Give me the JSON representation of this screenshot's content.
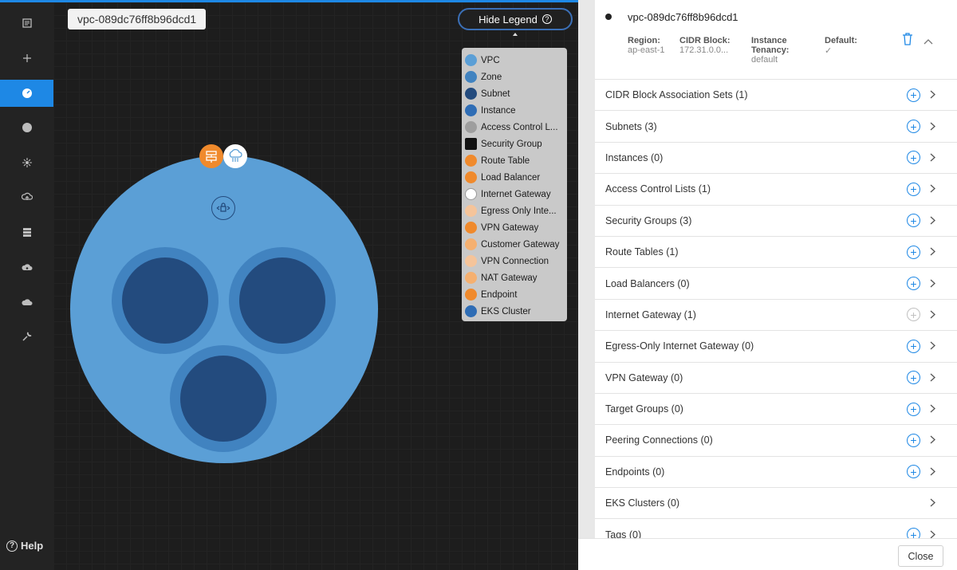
{
  "sidebar": {
    "items": [
      {
        "name": "dashboard-icon",
        "active": false
      },
      {
        "name": "add-icon",
        "active": false
      },
      {
        "name": "gauge-icon",
        "active": true
      },
      {
        "name": "compass-icon",
        "active": false
      },
      {
        "name": "network-icon",
        "active": false
      },
      {
        "name": "cloud-upload-icon",
        "active": false
      },
      {
        "name": "server-icon",
        "active": false
      },
      {
        "name": "cloud-gear-icon",
        "active": false
      },
      {
        "name": "cloud-icon",
        "active": false
      },
      {
        "name": "wrench-icon",
        "active": false
      }
    ],
    "help_label": "Help"
  },
  "canvas": {
    "vpc_tag": "vpc-089dc76ff8b96dcd1",
    "hide_legend_label": "Hide Legend",
    "legend": [
      {
        "label": "VPC",
        "color": "#5b9fd6",
        "icon": "vpc-icon"
      },
      {
        "label": "Zone",
        "color": "#4183c0",
        "icon": "zone-icon"
      },
      {
        "label": "Subnet",
        "color": "#234b7e",
        "icon": "subnet-icon"
      },
      {
        "label": "Instance",
        "color": "#2f6db5",
        "icon": "instance-icon"
      },
      {
        "label": "Access Control L...",
        "color": "#9e9e9e",
        "icon": "acl-icon"
      },
      {
        "label": "Security Group",
        "color": "#111111",
        "icon": "security-group-icon"
      },
      {
        "label": "Route Table",
        "color": "#f08a2c",
        "icon": "route-table-icon"
      },
      {
        "label": "Load Balancer",
        "color": "#f08a2c",
        "icon": "load-balancer-icon"
      },
      {
        "label": "Internet Gateway",
        "color": "#ffffff",
        "icon": "internet-gateway-icon"
      },
      {
        "label": "Egress Only Inte...",
        "color": "#f5c49a",
        "icon": "egress-gateway-icon"
      },
      {
        "label": "VPN Gateway",
        "color": "#f08a2c",
        "icon": "vpn-gateway-icon"
      },
      {
        "label": "Customer Gateway",
        "color": "#f5b070",
        "icon": "customer-gateway-icon"
      },
      {
        "label": "VPN Connection",
        "color": "#f5c49a",
        "icon": "vpn-connection-icon"
      },
      {
        "label": "NAT Gateway",
        "color": "#f5b070",
        "icon": "nat-gateway-icon"
      },
      {
        "label": "Endpoint",
        "color": "#f08a2c",
        "icon": "endpoint-icon"
      },
      {
        "label": "EKS Cluster",
        "color": "#2f6db5",
        "icon": "eks-cluster-icon"
      }
    ]
  },
  "panel": {
    "title": "vpc-089dc76ff8b96dcd1",
    "region_label": "Region:",
    "region_value": "ap-east-1",
    "cidr_label": "CIDR Block:",
    "cidr_value": "172.31.0.0...",
    "tenancy_label": "Instance Tenancy:",
    "tenancy_value": "default",
    "default_label": "Default:",
    "default_value": "✓",
    "rows": [
      {
        "label": "CIDR Block Association Sets (1)",
        "add": "enabled"
      },
      {
        "label": "Subnets (3)",
        "add": "enabled"
      },
      {
        "label": "Instances (0)",
        "add": "enabled"
      },
      {
        "label": "Access Control Lists (1)",
        "add": "enabled"
      },
      {
        "label": "Security Groups (3)",
        "add": "enabled"
      },
      {
        "label": "Route Tables (1)",
        "add": "enabled"
      },
      {
        "label": "Load Balancers (0)",
        "add": "enabled"
      },
      {
        "label": "Internet Gateway (1)",
        "add": "disabled"
      },
      {
        "label": "Egress-Only Internet Gateway (0)",
        "add": "enabled"
      },
      {
        "label": "VPN Gateway (0)",
        "add": "enabled"
      },
      {
        "label": "Target Groups (0)",
        "add": "enabled"
      },
      {
        "label": "Peering Connections (0)",
        "add": "enabled"
      },
      {
        "label": "Endpoints (0)",
        "add": "enabled"
      },
      {
        "label": "EKS Clusters (0)",
        "add": "none"
      },
      {
        "label": "Tags (0)",
        "add": "enabled"
      }
    ],
    "close_label": "Close"
  }
}
